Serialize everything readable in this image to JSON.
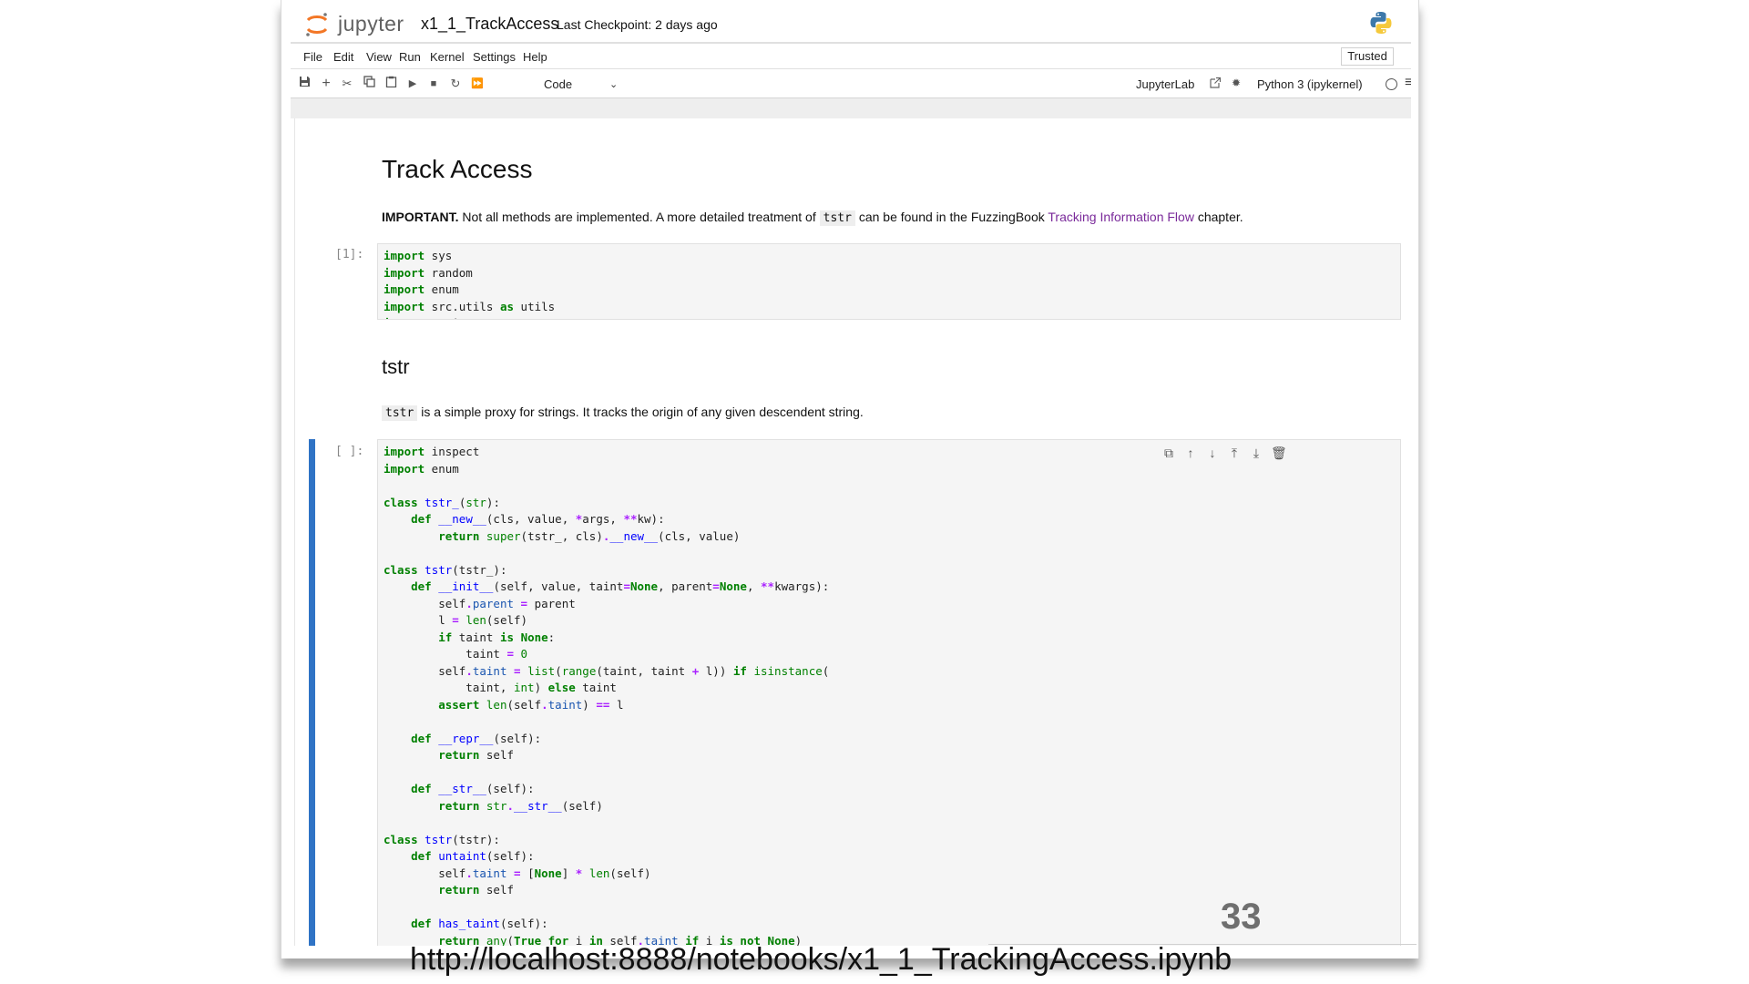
{
  "header": {
    "logo_text": "jupyter",
    "notebook_title": "x1_1_TrackAccess",
    "checkpoint": "Last Checkpoint: 2 days ago"
  },
  "menu": {
    "items": [
      "File",
      "Edit",
      "View",
      "Run",
      "Kernel",
      "Settings",
      "Help"
    ],
    "trusted": "Trusted"
  },
  "toolbar": {
    "cell_type": "Code",
    "jupyterlab_link": "JupyterLab",
    "kernel_name": "Python 3 (ipykernel)"
  },
  "notebook": {
    "title": "Track Access",
    "important_bold": "IMPORTANT.",
    "important_text_1": " Not all methods are implemented. A more detailed treatment of ",
    "important_code": "tstr",
    "important_text_2": " can be found in the FuzzingBook ",
    "important_link": "Tracking Information Flow",
    "important_text_3": " chapter.",
    "cell1_prompt": "[1]:",
    "section_title": "tstr",
    "tstr_code": "tstr",
    "tstr_desc": " is a simple proxy for strings. It tracks the origin of any given descendent string.",
    "cell2_prompt": "[ ]:"
  },
  "slide": {
    "number": "33",
    "url": "http://localhost:8888/notebooks/x1_1_TrackingAccess.ipynb"
  },
  "colors": {
    "active_cell": "#2f73c5",
    "link": "#7a2a9a",
    "keyword": "#008000"
  }
}
